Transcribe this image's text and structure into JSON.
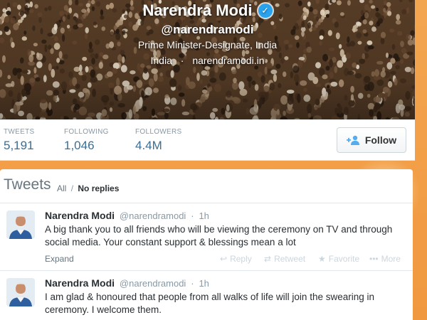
{
  "profile": {
    "name": "Narendra Modi",
    "handle": "@narendramodi",
    "bio": "Prime Minister-Designate, India",
    "location": "India",
    "separator": "·",
    "website": "narendramodi.in"
  },
  "stats": {
    "tweets_label": "TWEETS",
    "tweets_value": "5,191",
    "following_label": "FOLLOWING",
    "following_value": "1,046",
    "followers_label": "FOLLOWERS",
    "followers_value": "4.4M",
    "follow_button": "Follow"
  },
  "timeline": {
    "title": "Tweets",
    "filter_all": "All",
    "filter_sep": "/",
    "filter_no_replies": "No replies"
  },
  "tweets": [
    {
      "name": "Narendra Modi",
      "handle": "@narendramodi",
      "separator": "·",
      "time": "1h",
      "text": "A big thank you to all friends who will be viewing the ceremony on TV and through social media. Your constant support & blessings mean a lot",
      "expand": "Expand",
      "reply": "Reply",
      "retweet": "Retweet",
      "favorite": "Favorite",
      "more": "More"
    },
    {
      "name": "Narendra Modi",
      "handle": "@narendramodi",
      "separator": "·",
      "time": "1h",
      "text": "I am glad & honoured that people from all walks of life will join the swearing in ceremony. I welcome them."
    }
  ],
  "icons": {
    "verified": "verified-badge-icon",
    "follow": "add-user-icon",
    "reply": "reply-icon",
    "retweet": "retweet-icon",
    "favorite": "star-icon",
    "more": "more-icon"
  },
  "colors": {
    "link": "#3b6e94",
    "verified": "#2aa3ef",
    "muted": "#8899a6",
    "action_faded": "#ccd6dd"
  }
}
